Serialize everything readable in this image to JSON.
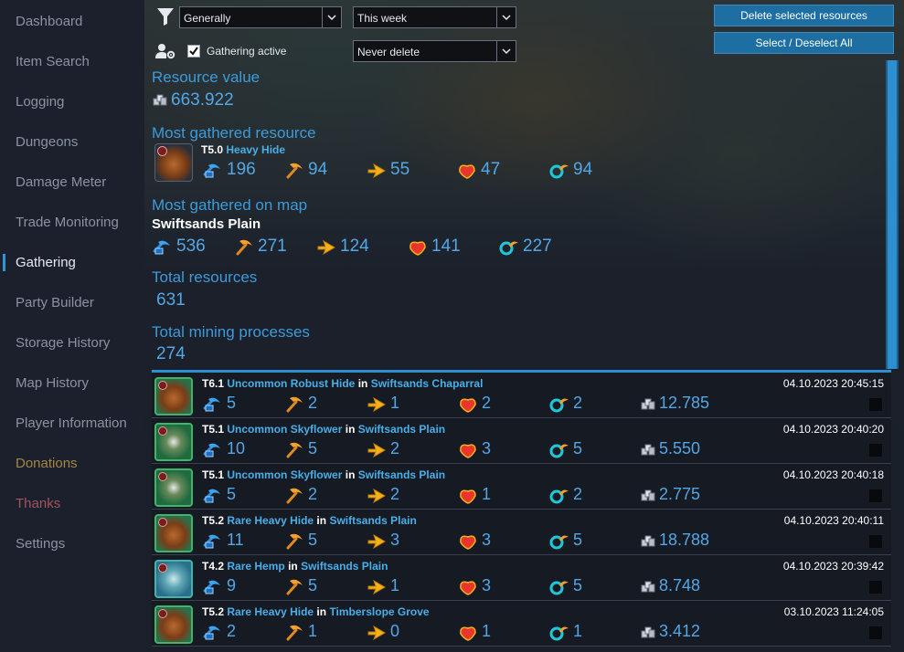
{
  "nav": {
    "items": [
      {
        "label": "Dashboard"
      },
      {
        "label": "Item Search"
      },
      {
        "label": "Logging"
      },
      {
        "label": "Dungeons"
      },
      {
        "label": "Damage Meter"
      },
      {
        "label": "Trade Monitoring"
      },
      {
        "label": "Gathering"
      },
      {
        "label": "Party Builder"
      },
      {
        "label": "Storage History"
      },
      {
        "label": "Map History"
      },
      {
        "label": "Player Information"
      },
      {
        "label": "Donations"
      },
      {
        "label": "Thanks"
      },
      {
        "label": "Settings"
      }
    ],
    "active": "Gathering"
  },
  "filters": {
    "category": "Generally",
    "period": "This week",
    "gathering_active_label": "Gathering active",
    "gathering_active_checked": true,
    "delete_option": "Never delete"
  },
  "buttons": {
    "delete_selected": "Delete selected resources",
    "select_deselect_all": "Select / Deselect All"
  },
  "stats": {
    "resource_value_label": "Resource value",
    "resource_value": "663.922",
    "most_gathered_label": "Most gathered resource",
    "most_gathered_tier": "T5.0",
    "most_gathered_name": "Heavy Hide",
    "most_gathered_counts": [
      "196",
      "94",
      "55",
      "47",
      "94"
    ],
    "most_on_map_label": "Most gathered on map",
    "most_on_map_name": "Swiftsands Plain",
    "most_on_map_counts": [
      "536",
      "271",
      "124",
      "141",
      "227"
    ],
    "total_resources_label": "Total resources",
    "total_resources": "631",
    "total_mining_label": "Total mining processes",
    "total_mining": "274"
  },
  "rows": [
    {
      "tier": "T6.1",
      "name": "Uncommon Robust Hide",
      "in": "in",
      "map": "Swiftsands Chaparral",
      "date": "04.10.2023 20:45:15",
      "counts": [
        "5",
        "2",
        "1",
        "2",
        "2"
      ],
      "value": "12.785",
      "icon": "hide"
    },
    {
      "tier": "T5.1",
      "name": "Uncommon Skyflower",
      "in": "in",
      "map": "Swiftsands Plain",
      "date": "04.10.2023 20:40:20",
      "counts": [
        "10",
        "5",
        "2",
        "3",
        "5"
      ],
      "value": "5.550",
      "icon": "flower"
    },
    {
      "tier": "T5.1",
      "name": "Uncommon Skyflower",
      "in": "in",
      "map": "Swiftsands Plain",
      "date": "04.10.2023 20:40:18",
      "counts": [
        "5",
        "2",
        "2",
        "1",
        "2"
      ],
      "value": "2.775",
      "icon": "flower"
    },
    {
      "tier": "T5.2",
      "name": "Rare Heavy Hide",
      "in": "in",
      "map": "Swiftsands Plain",
      "date": "04.10.2023 20:40:11",
      "counts": [
        "11",
        "5",
        "3",
        "3",
        "5"
      ],
      "value": "18.788",
      "icon": "hide"
    },
    {
      "tier": "T4.2",
      "name": "Rare Hemp",
      "in": "in",
      "map": "Swiftsands Plain",
      "date": "04.10.2023 20:39:42",
      "counts": [
        "9",
        "5",
        "1",
        "3",
        "5"
      ],
      "value": "8.748",
      "icon": "hemp"
    },
    {
      "tier": "T5.2",
      "name": "Rare Heavy Hide",
      "in": "in",
      "map": "Timberslope Grove",
      "date": "03.10.2023 11:24:05",
      "counts": [
        "2",
        "1",
        "0",
        "1",
        "1"
      ],
      "value": "3.412",
      "icon": "hide"
    }
  ],
  "colors": {
    "accent": "#2d8fd0",
    "button": "#1c6ea3",
    "value_text": "#53a7e6",
    "donations": "#a48645",
    "thanks": "#a15460"
  }
}
